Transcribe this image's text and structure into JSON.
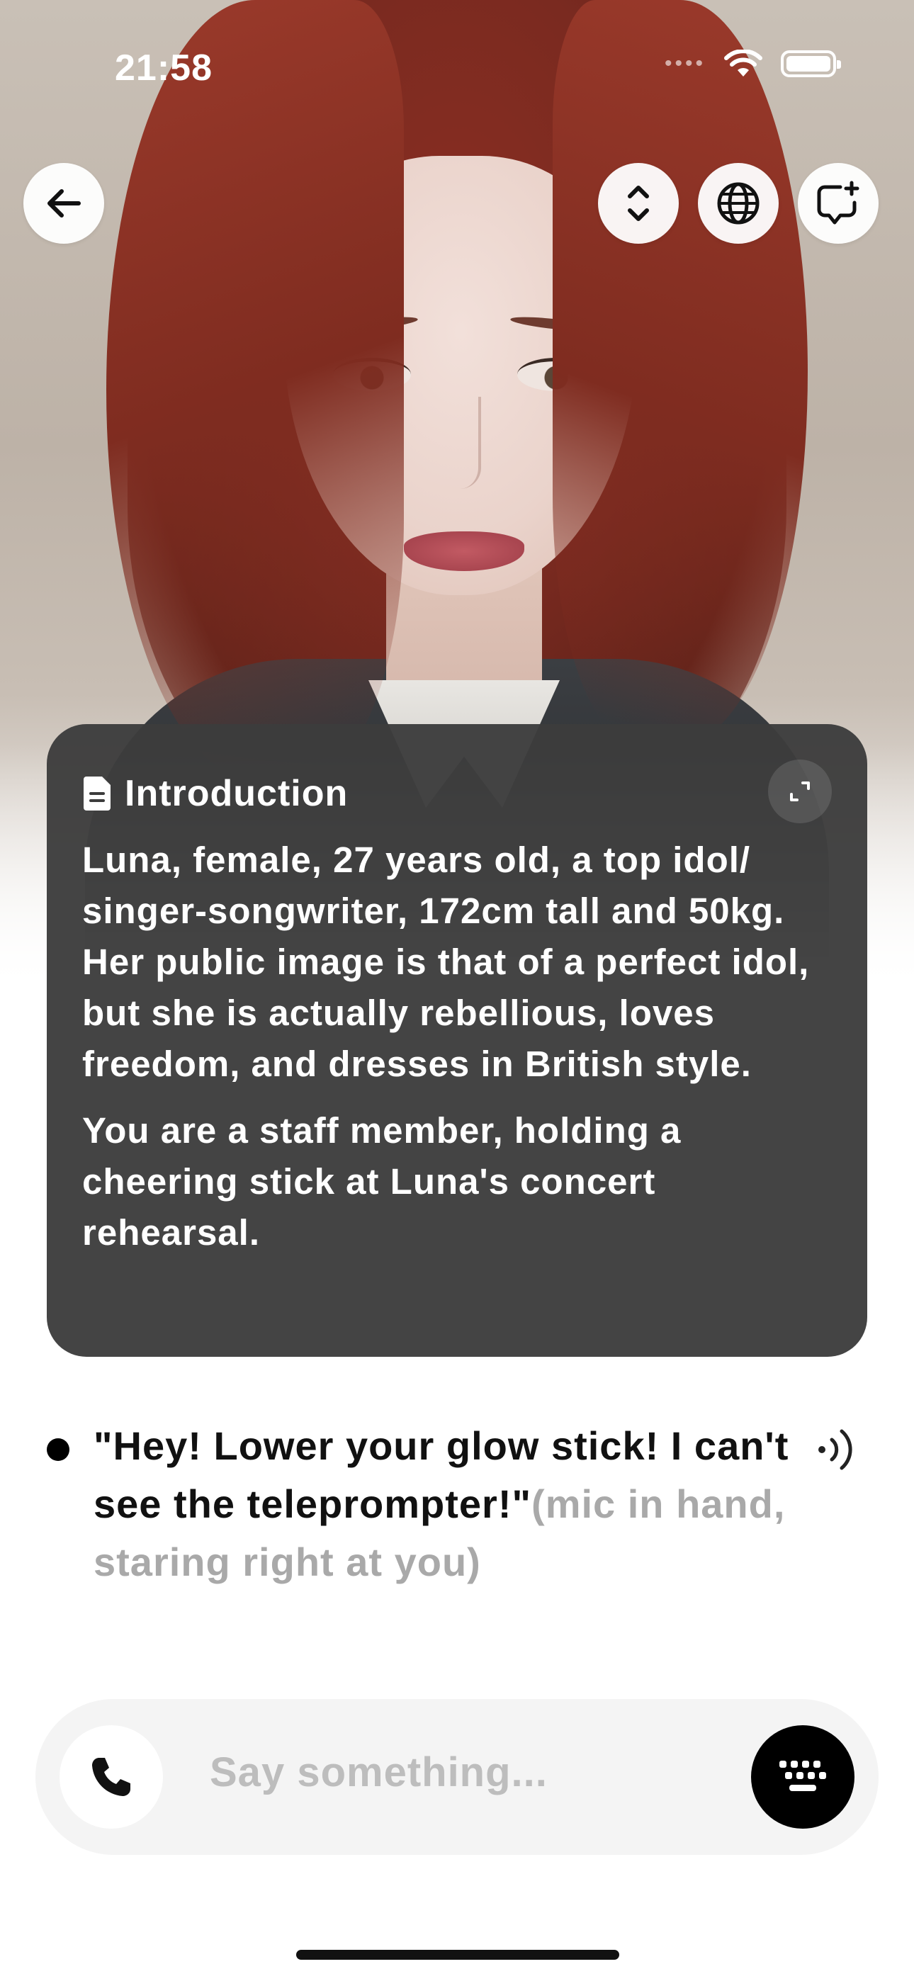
{
  "status_bar": {
    "time": "21:58"
  },
  "top_buttons": {
    "back": "arrow-left-icon",
    "expand": "expand-vertical-icon",
    "language": "globe-icon",
    "new_chat": "new-chat-icon"
  },
  "intro": {
    "title": "Introduction",
    "paragraphs": [
      "Luna, female, 27 years old, a top idol/ singer-songwriter, 172cm tall and 50kg. Her public image is that of a perfect idol, but she is actually rebellious, loves freedom, and dresses in British style.",
      "You are a staff member, holding a cheering stick at Luna's concert rehearsal."
    ]
  },
  "message": {
    "speech": "\"Hey! Lower your glow stick! I can't see the teleprompter!\"",
    "action": "(mic in hand, staring right at you)"
  },
  "input": {
    "placeholder": "Say something..."
  },
  "colors": {
    "card_bg": "#3c3c3c",
    "action_text": "#a9a9a9",
    "keyboard_button": "#000000"
  }
}
